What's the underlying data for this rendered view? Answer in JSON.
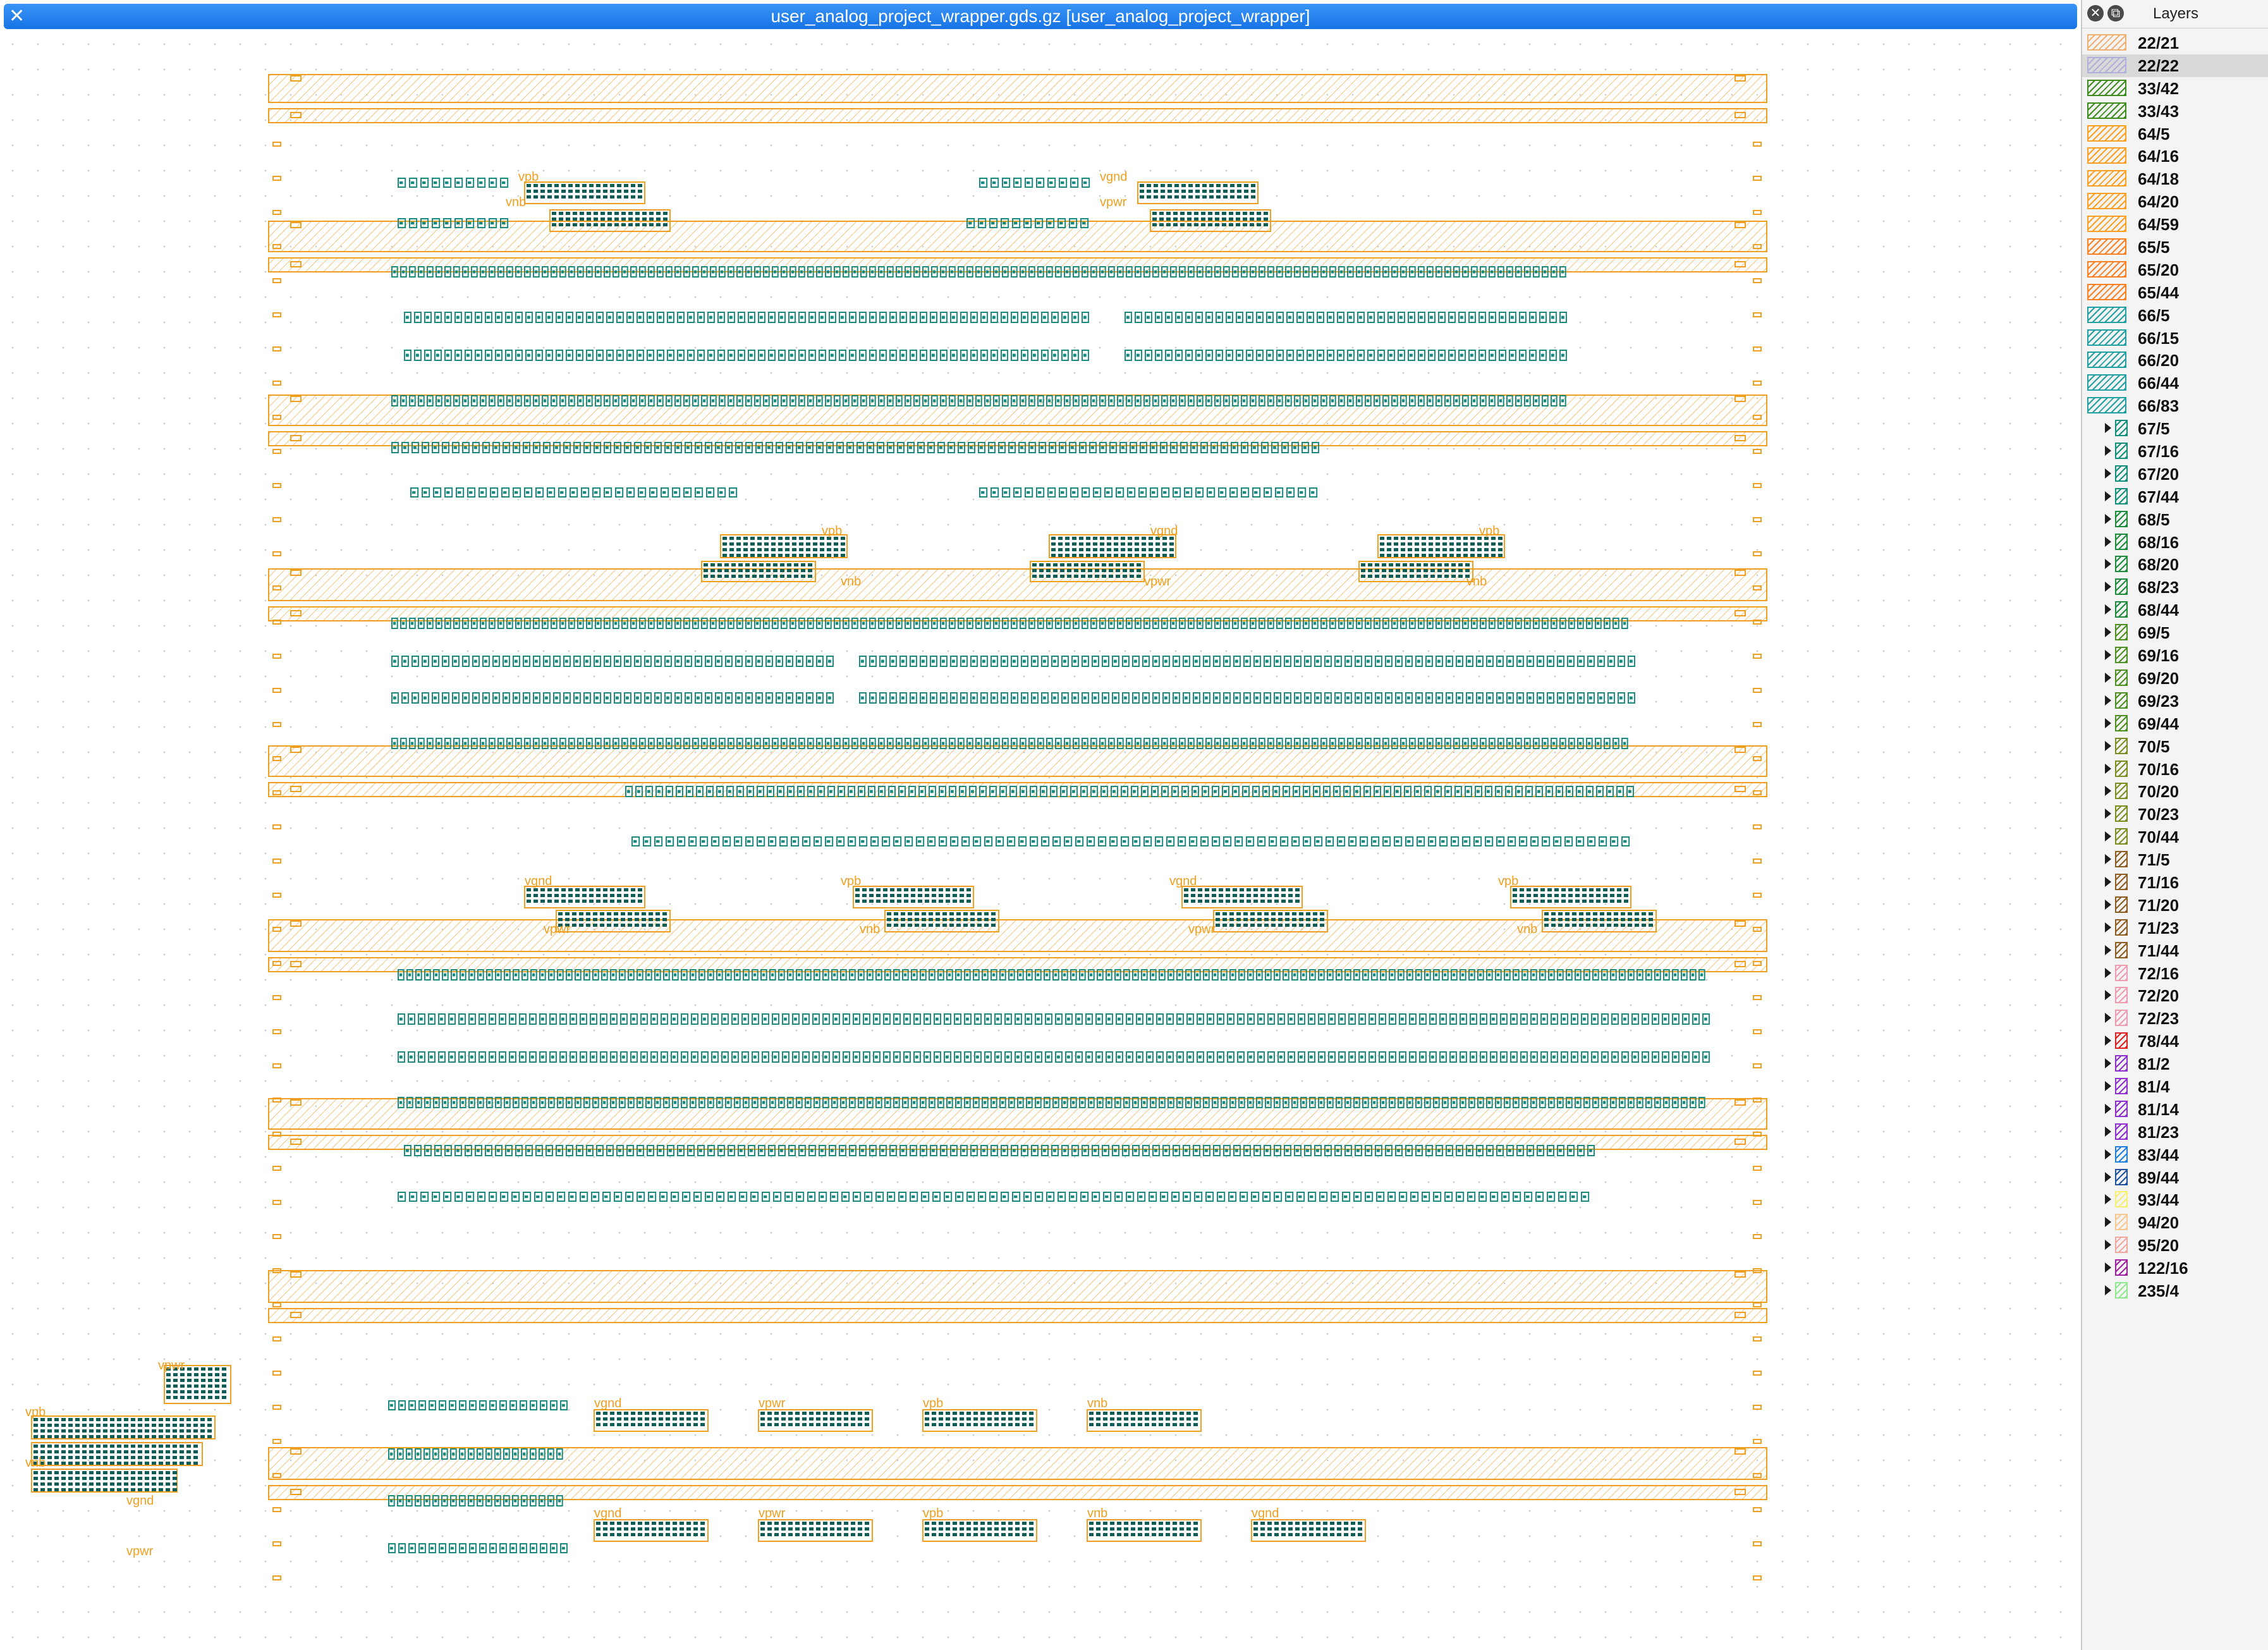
{
  "window": {
    "title": "user_analog_project_wrapper.gds.gz [user_analog_project_wrapper]",
    "close_glyph": "✕"
  },
  "layers_panel": {
    "title": "Layers",
    "close_glyph": "✕",
    "float_glyph": "⧉",
    "items": [
      {
        "label": "22/21",
        "color": "#f0b070",
        "expandable": false,
        "selected": false
      },
      {
        "label": "22/22",
        "color": "#b0b0d8",
        "expandable": false,
        "selected": true
      },
      {
        "label": "33/42",
        "color": "#3c8c1e",
        "expandable": false,
        "selected": false
      },
      {
        "label": "33/43",
        "color": "#3c8c1e",
        "expandable": false,
        "selected": false
      },
      {
        "label": "64/5",
        "color": "#ffa020",
        "expandable": false,
        "selected": false
      },
      {
        "label": "64/16",
        "color": "#ffa020",
        "expandable": false,
        "selected": false
      },
      {
        "label": "64/18",
        "color": "#ffa020",
        "expandable": false,
        "selected": false
      },
      {
        "label": "64/20",
        "color": "#ffa020",
        "expandable": false,
        "selected": false
      },
      {
        "label": "64/59",
        "color": "#ffa020",
        "expandable": false,
        "selected": false
      },
      {
        "label": "65/5",
        "color": "#ff8020",
        "expandable": false,
        "selected": false
      },
      {
        "label": "65/20",
        "color": "#ff8020",
        "expandable": false,
        "selected": false
      },
      {
        "label": "65/44",
        "color": "#ff8020",
        "expandable": false,
        "selected": false
      },
      {
        "label": "66/5",
        "color": "#20a0a0",
        "expandable": false,
        "selected": false
      },
      {
        "label": "66/15",
        "color": "#20a0a0",
        "expandable": false,
        "selected": false
      },
      {
        "label": "66/20",
        "color": "#20a0a0",
        "expandable": false,
        "selected": false
      },
      {
        "label": "66/44",
        "color": "#20a0a0",
        "expandable": false,
        "selected": false
      },
      {
        "label": "66/83",
        "color": "#20a0a0",
        "expandable": false,
        "selected": false
      },
      {
        "label": "67/5",
        "color": "#10907a",
        "expandable": true,
        "selected": false
      },
      {
        "label": "67/16",
        "color": "#10907a",
        "expandable": true,
        "selected": false
      },
      {
        "label": "67/20",
        "color": "#10907a",
        "expandable": true,
        "selected": false
      },
      {
        "label": "67/44",
        "color": "#10907a",
        "expandable": true,
        "selected": false
      },
      {
        "label": "68/5",
        "color": "#1c8c3c",
        "expandable": true,
        "selected": false
      },
      {
        "label": "68/16",
        "color": "#1c8c3c",
        "expandable": true,
        "selected": false
      },
      {
        "label": "68/20",
        "color": "#1c8c3c",
        "expandable": true,
        "selected": false
      },
      {
        "label": "68/23",
        "color": "#1c8c3c",
        "expandable": true,
        "selected": false
      },
      {
        "label": "68/44",
        "color": "#1c8c3c",
        "expandable": true,
        "selected": false
      },
      {
        "label": "69/5",
        "color": "#4c9020",
        "expandable": true,
        "selected": false
      },
      {
        "label": "69/16",
        "color": "#4c9020",
        "expandable": true,
        "selected": false
      },
      {
        "label": "69/20",
        "color": "#4c9020",
        "expandable": true,
        "selected": false
      },
      {
        "label": "69/23",
        "color": "#4c9020",
        "expandable": true,
        "selected": false
      },
      {
        "label": "69/44",
        "color": "#4c9020",
        "expandable": true,
        "selected": false
      },
      {
        "label": "70/5",
        "color": "#7c8c20",
        "expandable": true,
        "selected": false
      },
      {
        "label": "70/16",
        "color": "#7c8c20",
        "expandable": true,
        "selected": false
      },
      {
        "label": "70/20",
        "color": "#7c8c20",
        "expandable": true,
        "selected": false
      },
      {
        "label": "70/23",
        "color": "#7c8c20",
        "expandable": true,
        "selected": false
      },
      {
        "label": "70/44",
        "color": "#7c8c20",
        "expandable": true,
        "selected": false
      },
      {
        "label": "71/5",
        "color": "#8c5c20",
        "expandable": true,
        "selected": false
      },
      {
        "label": "71/16",
        "color": "#8c5c20",
        "expandable": true,
        "selected": false
      },
      {
        "label": "71/20",
        "color": "#8c5c20",
        "expandable": true,
        "selected": false
      },
      {
        "label": "71/23",
        "color": "#8c5c20",
        "expandable": true,
        "selected": false
      },
      {
        "label": "71/44",
        "color": "#8c5c20",
        "expandable": true,
        "selected": false
      },
      {
        "label": "72/16",
        "color": "#f09cb0",
        "expandable": true,
        "selected": false
      },
      {
        "label": "72/20",
        "color": "#f09cb0",
        "expandable": true,
        "selected": false
      },
      {
        "label": "72/23",
        "color": "#f09cb0",
        "expandable": true,
        "selected": false
      },
      {
        "label": "78/44",
        "color": "#e02020",
        "expandable": true,
        "selected": false
      },
      {
        "label": "81/2",
        "color": "#8c30d0",
        "expandable": true,
        "selected": false
      },
      {
        "label": "81/4",
        "color": "#8c30d0",
        "expandable": true,
        "selected": false
      },
      {
        "label": "81/14",
        "color": "#8c30d0",
        "expandable": true,
        "selected": false
      },
      {
        "label": "81/23",
        "color": "#8c30d0",
        "expandable": true,
        "selected": false
      },
      {
        "label": "83/44",
        "color": "#2080e0",
        "expandable": true,
        "selected": false
      },
      {
        "label": "89/44",
        "color": "#2050a0",
        "expandable": true,
        "selected": false
      },
      {
        "label": "93/44",
        "color": "#f8f070",
        "expandable": true,
        "selected": false
      },
      {
        "label": "94/20",
        "color": "#f8c890",
        "expandable": true,
        "selected": false
      },
      {
        "label": "95/20",
        "color": "#f0a8a0",
        "expandable": true,
        "selected": false
      },
      {
        "label": "122/16",
        "color": "#a020a0",
        "expandable": true,
        "selected": false
      },
      {
        "label": "235/4",
        "color": "#90e890",
        "expandable": true,
        "selected": false
      }
    ]
  },
  "layout_view": {
    "colors": {
      "metal": "#f0a020",
      "cell": "#1a8a80",
      "cell_dark": "#0d5c56",
      "label": "#f0a020"
    },
    "net_labels": [
      "vpb",
      "vnb",
      "vgnd",
      "vpwr"
    ]
  }
}
